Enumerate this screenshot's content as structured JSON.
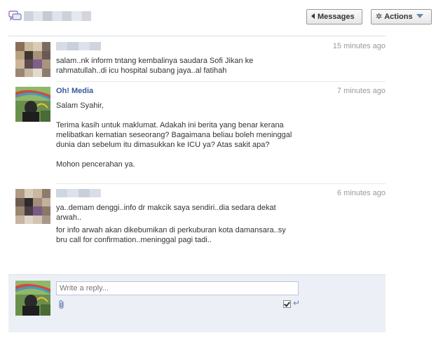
{
  "header": {
    "messages_label": "Messages",
    "actions_label": "Actions",
    "icons": [
      "messages-icon",
      "back-arrow-icon",
      "gear-icon",
      "dropdown-arrow-icon"
    ]
  },
  "thread": [
    {
      "sender": "",
      "time": "15 minutes ago",
      "paragraphs": [
        "salam..nk inform tntang kembalinya saudara Sofi Jikan ke rahmatullah..di icu hospital subang jaya..al fatihah"
      ]
    },
    {
      "sender": "Oh! Media",
      "time": "7 minutes ago",
      "paragraphs": [
        "Salam Syahir,",
        "Terima kasih untuk maklumat. Adakah ini berita yang benar kerana melibatkan kematian seseorang? Bagaimana beliau boleh meninggal dunia dan sebelum itu dimasukkan ke ICU ya? Atas sakit apa?",
        "Mohon pencerahan ya."
      ]
    },
    {
      "sender": "",
      "time": "6 minutes ago",
      "paragraphs": [
        "ya..demam denggi..info dr makcik saya sendiri..dia sedara dekat arwah..",
        "for info arwah akan dikebumikan di perkuburan kota damansara..sy bru call for confirmation..meninggal pagi tadi.."
      ]
    }
  ],
  "reply": {
    "placeholder": "Write a reply...",
    "enter_to_send_checked": true,
    "icons": [
      "attach-icon",
      "enter-icon"
    ]
  }
}
